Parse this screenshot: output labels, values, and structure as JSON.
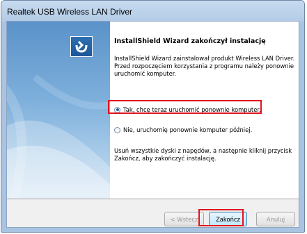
{
  "window": {
    "title": "Realtek USB Wireless LAN Driver"
  },
  "wizard": {
    "heading": "InstallShield Wizard zakończył instalację",
    "description": "InstallShield Wizard zainstalował produkt Wireless LAN Driver. Przed rozpoczęciem korzystania z programu należy ponownie uruchomić komputer.",
    "options": [
      {
        "label": "Tak, chcę teraz uruchomić ponownie komputer.",
        "selected": true
      },
      {
        "label": "Nie, uruchomię ponownie komputer później.",
        "selected": false
      }
    ],
    "note": "Usuń wszystkie dyski z napędów, a następnie kliknij przycisk Zakończ, aby zakończyć instalację."
  },
  "buttons": {
    "back": "< Wstecz",
    "finish": "Zakończ",
    "cancel": "Anuluj"
  },
  "colors": {
    "highlight": "#e0141e",
    "logo_background": "#1d5698"
  },
  "icons": {
    "logo": "installshield-logo-icon"
  }
}
